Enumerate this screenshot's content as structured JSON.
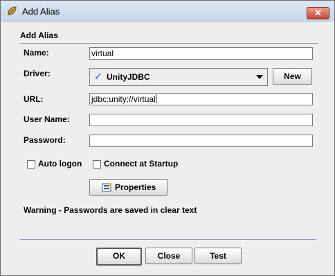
{
  "window": {
    "title": "Add Alias",
    "icon": "alias-leaf-icon",
    "close_label": "✕"
  },
  "group": {
    "title": "Add Alias"
  },
  "form": {
    "name_label": "Name:",
    "name_value": "virtual",
    "driver_label": "Driver:",
    "driver_value": "UnityJDBC",
    "driver_check": "✓",
    "new_button": "New",
    "url_label": "URL:",
    "url_value": "jdbc:unity://virtual",
    "username_label": "User Name:",
    "username_value": "",
    "password_label": "Password:",
    "password_value": "",
    "auto_logon_label": "Auto logon",
    "auto_logon_checked": false,
    "connect_startup_label": "Connect at Startup",
    "connect_startup_checked": false,
    "properties_button": "Properties"
  },
  "warning": "Warning - Passwords are saved in clear text",
  "footer": {
    "ok": "OK",
    "close": "Close",
    "test": "Test"
  }
}
